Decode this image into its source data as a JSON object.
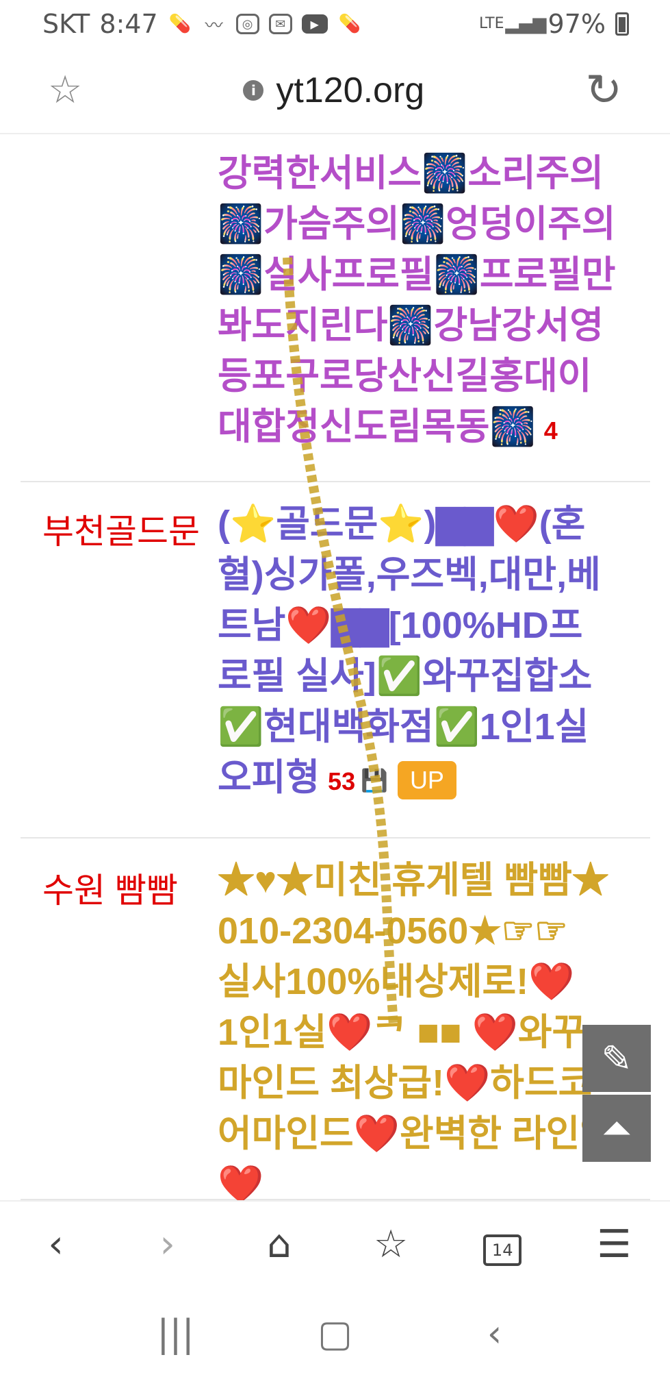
{
  "status_bar": {
    "carrier": "SKT",
    "time": "8:47",
    "network": "LTE",
    "battery": "97%"
  },
  "url_bar": {
    "url": "yt120.org"
  },
  "listings": [
    {
      "category": "",
      "lines": [
        "강력한서비스🎆소리주의",
        "🎆가슴주의🎆엉덩이주의",
        "🎆실사프로필🎆프로필만",
        "봐도지린다🎆강남강서영",
        "등포구로당산신길홍대이",
        "대합정신도림목동🎆"
      ],
      "count": "4"
    },
    {
      "category": "부천골드문",
      "lines": [
        "(⭐골드문⭐)▇▇❤️(혼",
        "혈)싱가폴,우즈벡,대만,베",
        "트남❤️▇▇[100%HD프",
        "로필 실사]✅와꾸집합소",
        "✅현대백화점✅1인1실",
        "오피형"
      ],
      "count": "53",
      "badge": "UP"
    },
    {
      "category": "수원 빰빰",
      "lines": [
        "★♥★미친 휴게텔 빰빰★",
        "010-2304-0560★☞☞",
        "실사100%내상제로!❤️",
        "1인1실❤️ᄏ ■■ ❤️와꾸",
        "마인드 최상급!❤️하드코",
        "어마인드❤️완벽한 라인업",
        "❤️"
      ]
    }
  ],
  "toolbar": {
    "tab_count": "14"
  },
  "icons": {
    "bookmark": "star-outline-icon",
    "reload": "reload-icon",
    "edit": "pencil-icon",
    "scroll_top": "scroll-top-icon"
  },
  "colors": {
    "category": "#e00000",
    "purple_text": "#b44ec8",
    "indigo_text": "#6a5acd",
    "gold_text": "#d2a52a",
    "up_badge": "#f5a623"
  }
}
